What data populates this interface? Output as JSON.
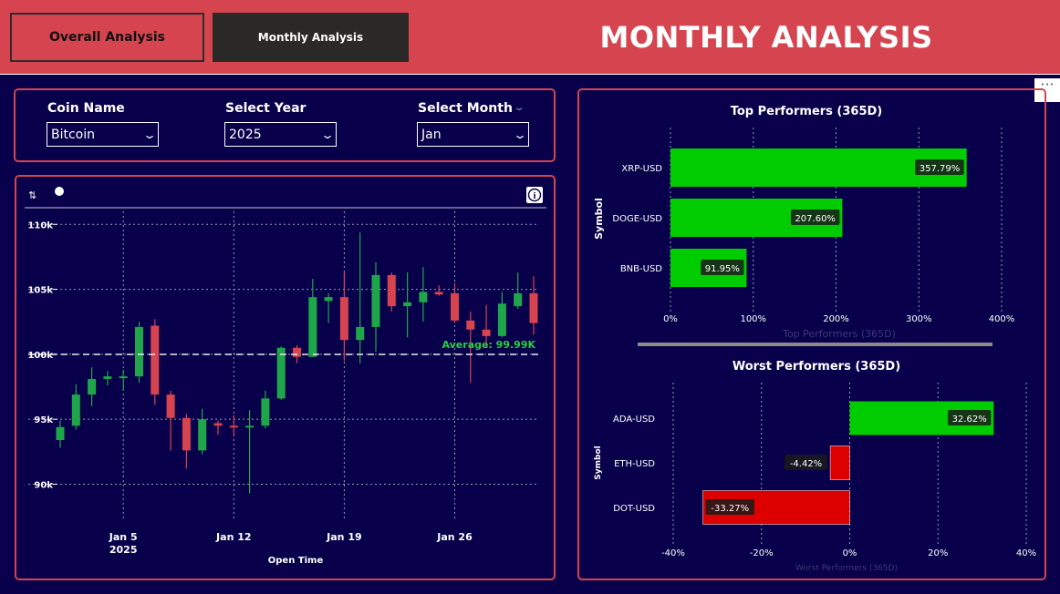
{
  "header": {
    "title": "MONTHLY ANALYSIS",
    "tabs": [
      {
        "label": "Overall Analysis"
      },
      {
        "label": "Monthly Analysis"
      }
    ]
  },
  "filters": {
    "coin": {
      "label": "Coin Name",
      "value": "Bitcoin"
    },
    "year": {
      "label": "Select Year",
      "value": "2025"
    },
    "month": {
      "label": "Select Month",
      "value": "Jan"
    }
  },
  "colors": {
    "accent": "#d6444f",
    "background": "#08004a",
    "up": "#1fa64a",
    "down": "#d6444f",
    "average": "#2ecc40",
    "top_bar": "#00cc00",
    "neg_bar": "#dd0000"
  },
  "chart_data": [
    {
      "type": "candlestick",
      "xlabel": "Open Time",
      "ylabel": "",
      "ylim": [
        88000,
        111000
      ],
      "yticks": [
        90000,
        95000,
        100000,
        105000,
        110000
      ],
      "ytick_labels": [
        "90k",
        "95k",
        "100k",
        "105k",
        "110k"
      ],
      "xticks": [
        {
          "day": 5,
          "label": "Jan 5",
          "sublabel": "2025"
        },
        {
          "day": 12,
          "label": "Jan 12"
        },
        {
          "day": 19,
          "label": "Jan 19"
        },
        {
          "day": 26,
          "label": "Jan 26"
        }
      ],
      "average": {
        "value": 99990,
        "label": "Average: 99.99K"
      },
      "candles": [
        {
          "date": "2025-01-01",
          "open": 93400,
          "high": 94900,
          "low": 92800,
          "close": 94400
        },
        {
          "date": "2025-01-02",
          "open": 94500,
          "high": 97700,
          "low": 94200,
          "close": 96900
        },
        {
          "date": "2025-01-03",
          "open": 96900,
          "high": 99000,
          "low": 96000,
          "close": 98100
        },
        {
          "date": "2025-01-04",
          "open": 98100,
          "high": 98700,
          "low": 97600,
          "close": 98300
        },
        {
          "date": "2025-01-05",
          "open": 98200,
          "high": 98800,
          "low": 97200,
          "close": 98300
        },
        {
          "date": "2025-01-06",
          "open": 98300,
          "high": 102500,
          "low": 97800,
          "close": 102100
        },
        {
          "date": "2025-01-07",
          "open": 102200,
          "high": 102700,
          "low": 96100,
          "close": 96900
        },
        {
          "date": "2025-01-08",
          "open": 96900,
          "high": 97200,
          "low": 92600,
          "close": 95100
        },
        {
          "date": "2025-01-09",
          "open": 95100,
          "high": 95400,
          "low": 91200,
          "close": 92600
        },
        {
          "date": "2025-01-10",
          "open": 92600,
          "high": 95800,
          "low": 92300,
          "close": 95000
        },
        {
          "date": "2025-01-11",
          "open": 94700,
          "high": 94900,
          "low": 93800,
          "close": 94500
        },
        {
          "date": "2025-01-12",
          "open": 94500,
          "high": 95300,
          "low": 93800,
          "close": 94400
        },
        {
          "date": "2025-01-13",
          "open": 94500,
          "high": 95700,
          "low": 89300,
          "close": 94500
        },
        {
          "date": "2025-01-14",
          "open": 94500,
          "high": 97200,
          "low": 94300,
          "close": 96600
        },
        {
          "date": "2025-01-15",
          "open": 96600,
          "high": 100600,
          "low": 96500,
          "close": 100500
        },
        {
          "date": "2025-01-16",
          "open": 100500,
          "high": 100700,
          "low": 99300,
          "close": 99800
        },
        {
          "date": "2025-01-17",
          "open": 99800,
          "high": 105800,
          "low": 99800,
          "close": 104400
        },
        {
          "date": "2025-01-18",
          "open": 104100,
          "high": 104700,
          "low": 102400,
          "close": 104400
        },
        {
          "date": "2025-01-19",
          "open": 104400,
          "high": 106300,
          "low": 99500,
          "close": 101100
        },
        {
          "date": "2025-01-20",
          "open": 101100,
          "high": 109400,
          "low": 99300,
          "close": 102100
        },
        {
          "date": "2025-01-21",
          "open": 102100,
          "high": 107100,
          "low": 100200,
          "close": 106100
        },
        {
          "date": "2025-01-22",
          "open": 106100,
          "high": 106300,
          "low": 103300,
          "close": 103700
        },
        {
          "date": "2025-01-23",
          "open": 103700,
          "high": 106300,
          "low": 101300,
          "close": 104000
        },
        {
          "date": "2025-01-24",
          "open": 104000,
          "high": 106700,
          "low": 102500,
          "close": 104800
        },
        {
          "date": "2025-01-25",
          "open": 104800,
          "high": 105300,
          "low": 104500,
          "close": 104600
        },
        {
          "date": "2025-01-26",
          "open": 104700,
          "high": 105500,
          "low": 102400,
          "close": 102600
        },
        {
          "date": "2025-01-27",
          "open": 102600,
          "high": 103300,
          "low": 97800,
          "close": 101900
        },
        {
          "date": "2025-01-28",
          "open": 101900,
          "high": 103800,
          "low": 100500,
          "close": 101400
        },
        {
          "date": "2025-01-29",
          "open": 101400,
          "high": 104800,
          "low": 101300,
          "close": 103900
        },
        {
          "date": "2025-01-30",
          "open": 103700,
          "high": 106300,
          "low": 103500,
          "close": 104700
        },
        {
          "date": "2025-01-31",
          "open": 104700,
          "high": 106000,
          "low": 101500,
          "close": 102400
        }
      ]
    },
    {
      "type": "bar",
      "orientation": "horizontal",
      "title": "Top Performers (365D)",
      "xlabel": "Top Performers (365D)",
      "ylabel": "Symbol",
      "categories": [
        "XRP-USD",
        "DOGE-USD",
        "BNB-USD"
      ],
      "values": [
        357.79,
        207.6,
        91.95
      ],
      "value_labels": [
        "357.79%",
        "207.60%",
        "91.95%"
      ],
      "xlim": [
        0,
        400
      ],
      "xticks": [
        0,
        100,
        200,
        300,
        400
      ],
      "xtick_labels": [
        "0%",
        "100%",
        "200%",
        "300%",
        "400%"
      ]
    },
    {
      "type": "bar",
      "orientation": "horizontal",
      "title": "Worst Performers (365D)",
      "xlabel": "Worst Performers (365D)",
      "ylabel": "Symbol",
      "categories": [
        "ADA-USD",
        "ETH-USD",
        "DOT-USD"
      ],
      "values": [
        32.62,
        -4.42,
        -33.27
      ],
      "value_labels": [
        "32.62%",
        "-4.42%",
        "-33.27%"
      ],
      "xlim": [
        -40,
        40
      ],
      "xticks": [
        -40,
        -20,
        0,
        20,
        40
      ],
      "xtick_labels": [
        "-40%",
        "-20%",
        "0%",
        "20%",
        "40%"
      ]
    }
  ]
}
